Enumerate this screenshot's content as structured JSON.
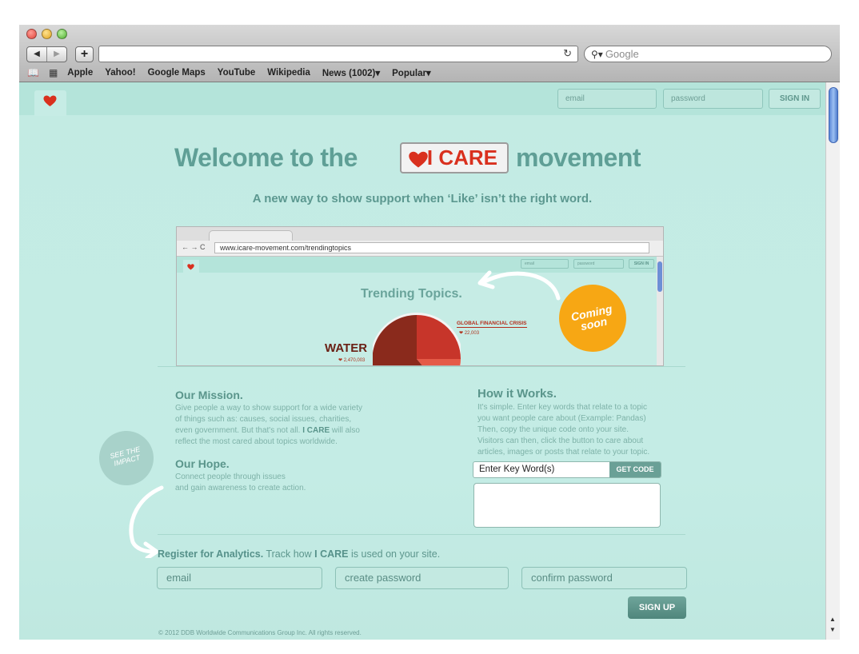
{
  "browser": {
    "url": "",
    "search_placeholder": "Google",
    "bookmarks": [
      "Apple",
      "Yahoo!",
      "Google Maps",
      "YouTube",
      "Wikipedia",
      "News (1002)▾",
      "Popular▾"
    ],
    "nav_back": "◀",
    "nav_forward": "▶",
    "new_tab": "+",
    "reload_icon": "↻"
  },
  "site": {
    "top_email_placeholder": "email",
    "top_password_placeholder": "password",
    "sign_in": "SIGN IN",
    "hero_prefix": "Welcome to the",
    "hero_brand": "I CARE",
    "hero_suffix": "movement",
    "tagline": "A new way to show support when ‘Like’ isn’t the right word.",
    "preview": {
      "url": "www.icare-movement.com/trendingtopics",
      "email": "email",
      "password": "password",
      "sign_in": "SIGN IN",
      "title": "Trending Topics.",
      "water_label": "WATER",
      "water_count": "2,470,003",
      "gfc_label": "GLOBAL FINANCIAL CRISIS",
      "gfc_count": "22,003",
      "coming_soon_line1": "Coming",
      "coming_soon_line2": "soon"
    },
    "mission_title": "Our Mission.",
    "mission_text_1": "Give people a way to show support for a wide variety",
    "mission_text_2": "of things such as: causes, social issues, charities,",
    "mission_text_3": "even government. But that's not all.",
    "mission_text_3b": "I CARE",
    "mission_text_3c": "will also",
    "mission_text_4": "reflect the most cared about topics worldwide.",
    "hope_title": "Our Hope.",
    "hope_text_1": "Connect people through issues",
    "hope_text_2": "and gain awareness to create action.",
    "see_impact_1": "SEE THE",
    "see_impact_2": "IMPACT",
    "how_title": "How it Works.",
    "how_text_1": "It's simple. Enter key words that relate to a topic",
    "how_text_2": "you want people care about (Example: Pandas)",
    "how_text_3": "Then, copy the unique code onto your site.",
    "how_text_4": "Visitors can then, click the button to care about",
    "how_text_5": "articles, images or posts that relate to your topic.",
    "keyword_value": "Enter Key Word(s)",
    "get_code": "GET CODE",
    "register_bold": "Register for Analytics.",
    "register_pre": "Track how",
    "register_brand": "I CARE",
    "register_post": "is used on your site.",
    "reg_email": "email",
    "reg_password": "create password",
    "reg_confirm": "confirm password",
    "sign_up": "SIGN UP",
    "footer": "© 2012 DDB Worldwide Communications Group Inc. All rights reserved."
  },
  "chart_data": {
    "type": "pie",
    "labels": [
      "WATER",
      "GLOBAL FINANCIAL CRISIS"
    ],
    "values": [
      2470003,
      22003
    ]
  },
  "colors": {
    "accent": "#d9301e",
    "mint": "#c6ece5",
    "teal_text": "#5f9f96",
    "coming_soon": "#f7a714"
  }
}
